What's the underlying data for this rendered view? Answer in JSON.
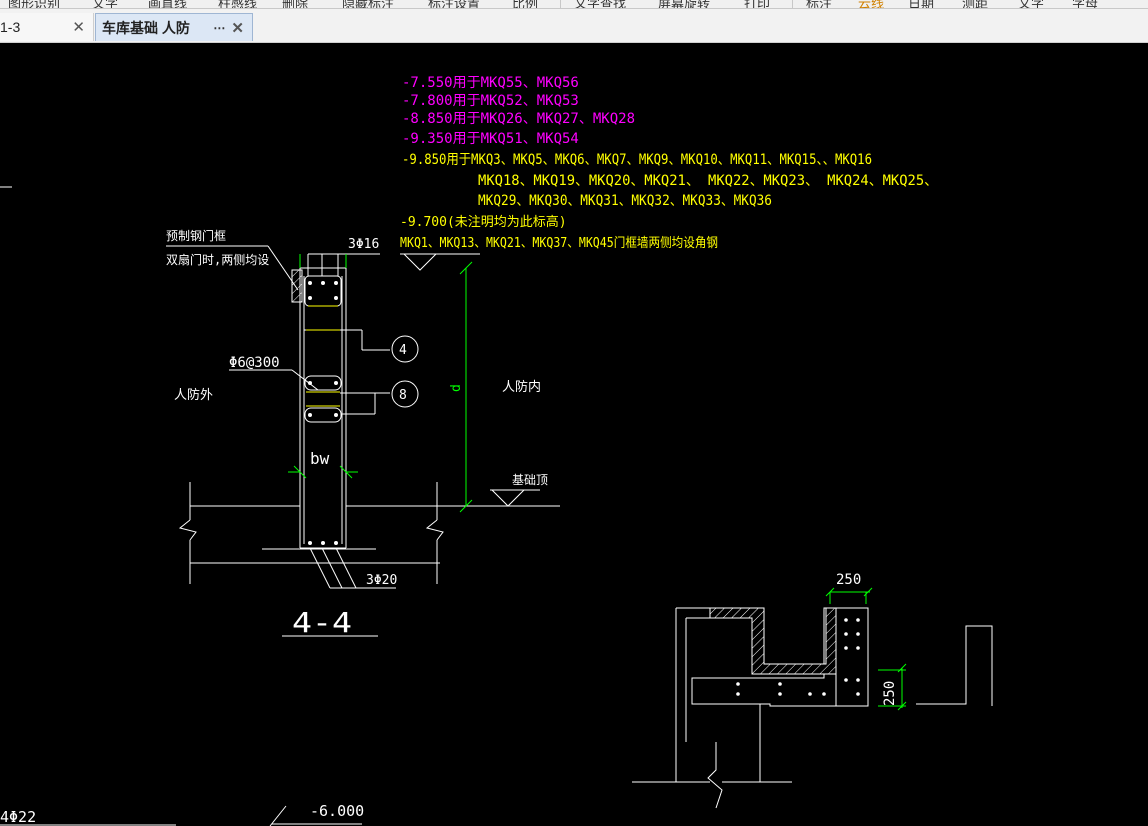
{
  "menu": {
    "items": [
      "图形识别",
      "文字",
      "画直线",
      "柱感线",
      "删除",
      "隐藏标注",
      "标注设置",
      "比例",
      "文字查找",
      "屏幕旋转",
      "打印",
      "标注",
      "云线",
      "日期",
      "测距",
      "文字",
      "字母"
    ]
  },
  "tabs": [
    {
      "label": "1-3",
      "active": false
    },
    {
      "label": "车库基础 人防",
      "active": true
    }
  ],
  "tab_icons": {
    "more": "⋯",
    "close": "✕"
  },
  "drawing": {
    "notes_magenta": [
      "-7.550用于MKQ55、MKQ56",
      "-7.800用于MKQ52、MKQ53",
      "-8.850用于MKQ26、MKQ27、MKQ28",
      "-9.350用于MKQ51、MKQ54"
    ],
    "notes_yellow": [
      "-9.850用于MKQ3、MKQ5、MKQ6、MKQ7、MKQ9、MKQ10、MKQ11、MKQ15、、MKQ16",
      "MKQ18、MKQ19、MKQ20、MKQ21、     MKQ22、MKQ23、   MKQ24、MKQ25、",
      "MKQ29、MKQ30、MKQ31、MKQ32、MKQ33、MKQ36",
      "-9.700(未注明均为此标高)",
      "MKQ1、MKQ13、MKQ21、MKQ37、MKQ45门框墙两侧均设角钢"
    ],
    "label_precast_1": "预制钢门框",
    "label_precast_2": "双扇门时,两侧均设",
    "label_top_rebar": "3Φ16",
    "label_stirrup": "Φ6@300",
    "label_outside": "人防外",
    "label_inside": "人防内",
    "label_bw": "bw",
    "label_d": "d",
    "label_foundation_top": "基础顶",
    "label_bottom_rebar": "3Φ20",
    "label_section": "4-4",
    "circle_4": "4",
    "circle_8": "8",
    "dim_250_top": "250",
    "dim_250_side": "250",
    "bottom_left_text": "4Φ22",
    "bottom_elev": "-6.000"
  },
  "colors": {
    "magenta": "#ff00ff",
    "yellow": "#ffff00",
    "green": "#00ff00",
    "white": "#ffffff",
    "background": "#000000"
  }
}
